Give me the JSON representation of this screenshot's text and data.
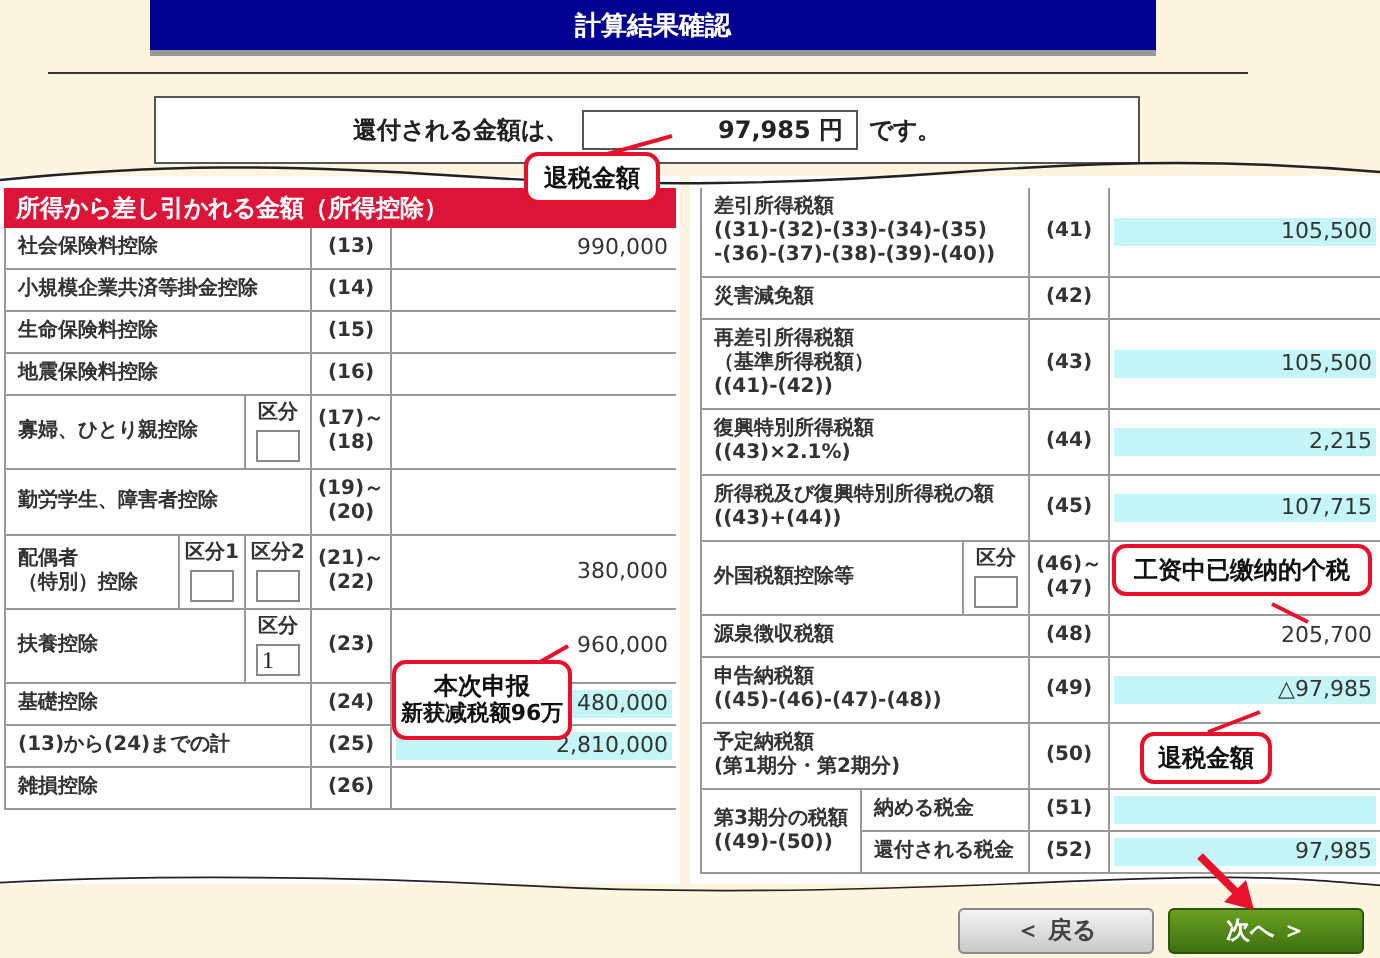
{
  "title": "計算結果確認",
  "refund": {
    "label": "還付される金額は、",
    "value": "97,985",
    "unit": "円",
    "suffix": "です。"
  },
  "left_table": {
    "header": "所得から差し引かれる金額（所得控除）",
    "rows": [
      {
        "label": [
          "社会保険料控除"
        ],
        "code": [
          "(13)"
        ],
        "amount": "990,000",
        "highlighted": false
      },
      {
        "label": [
          "小規模企業共済等掛金控除"
        ],
        "code": [
          "(14)"
        ],
        "highlighted": false
      },
      {
        "label": [
          "生命保険料控除"
        ],
        "code": [
          "(15)"
        ],
        "highlighted": false
      },
      {
        "label": [
          "地震保険料控除"
        ],
        "code": [
          "(16)"
        ],
        "highlighted": false
      },
      {
        "label": [
          "寡婦、ひとり親控除"
        ],
        "boxes": [
          {
            "label": "区分"
          }
        ],
        "code": [
          "(17)～",
          "(18)"
        ],
        "highlighted": false
      },
      {
        "label": [
          "勤労学生、障害者控除"
        ],
        "code": [
          "(19)～",
          "(20)"
        ],
        "highlighted": false
      },
      {
        "label": [
          "配偶者",
          "（特別）控除"
        ],
        "boxes": [
          {
            "label": "区分1"
          },
          {
            "label": "区分2"
          }
        ],
        "code": [
          "(21)～",
          "(22)"
        ],
        "amount": "380,000",
        "highlighted": false
      },
      {
        "label": [
          "扶養控除"
        ],
        "boxes": [
          {
            "label": "区分",
            "value": "1"
          }
        ],
        "code": [
          "(23)"
        ],
        "amount": "960,000",
        "highlighted": false
      },
      {
        "label": [
          "基礎控除"
        ],
        "code": [
          "(24)"
        ],
        "amount": "480,000",
        "highlighted": true
      },
      {
        "label": [
          "(13)から(24)までの計"
        ],
        "code": [
          "(25)"
        ],
        "amount": "2,810,000",
        "highlighted": true
      },
      {
        "label": [
          "雑損控除"
        ],
        "code": [
          "(26)"
        ],
        "highlighted": false
      }
    ]
  },
  "right_table": {
    "rows": [
      {
        "kind": "plain",
        "label": [
          "差引所得税額",
          "((31)-(32)-(33)-(34)-(35)",
          "-(36)-(37)-(38)-(39)-(40))"
        ],
        "code": [
          "(41)"
        ],
        "amount": "105,500",
        "highlighted": true
      },
      {
        "kind": "plain",
        "label": [
          "災害減免額"
        ],
        "code": [
          "(42)"
        ],
        "highlighted": false
      },
      {
        "kind": "plain",
        "label": [
          "再差引所得税額",
          "（基準所得税額）",
          "((41)-(42))"
        ],
        "code": [
          "(43)"
        ],
        "amount": "105,500",
        "highlighted": true
      },
      {
        "kind": "plain",
        "label": [
          "復興特別所得税額",
          "((43)×2.1%)"
        ],
        "code": [
          "(44)"
        ],
        "amount": "2,215",
        "highlighted": true
      },
      {
        "kind": "plain",
        "label": [
          "所得税及び復興特別所得税の額",
          "((43)+(44))"
        ],
        "code": [
          "(45)"
        ],
        "amount": "107,715",
        "highlighted": true
      },
      {
        "kind": "plain",
        "label": [
          "外国税額控除等"
        ],
        "boxes": [
          {
            "label": "区分"
          }
        ],
        "code": [
          "(46)～",
          "(47)"
        ],
        "highlighted": false
      },
      {
        "kind": "plain",
        "label": [
          "源泉徴収税額"
        ],
        "code": [
          "(48)"
        ],
        "amount": "205,700",
        "highlighted": false
      },
      {
        "kind": "plain",
        "label": [
          "申告納税額",
          "((45)-(46)-(47)-(48))"
        ],
        "code": [
          "(49)"
        ],
        "amount": "△97,985",
        "highlighted": true
      },
      {
        "kind": "plain",
        "label": [
          "予定納税額",
          "(第1期分・第2期分)"
        ],
        "code": [
          "(50)"
        ],
        "highlighted": false
      },
      {
        "kind": "group",
        "label": [
          "第3期分の税額",
          "((49)-(50))"
        ],
        "items": [
          {
            "label": "納める税金",
            "code": "(51)",
            "highlighted": true
          },
          {
            "label": "還付される税金",
            "code": "(52)",
            "amount": "97,985",
            "highlighted": true
          }
        ]
      }
    ]
  },
  "callouts": [
    [
      "退税金額"
    ],
    [
      "本次申报",
      "新获减税额96万"
    ],
    [
      "工资中已缴纳的个税"
    ],
    [
      "退税金額"
    ]
  ],
  "buttons": [
    {
      "label": "＜ 戻る",
      "kind": "back"
    },
    {
      "label": "次へ ＞",
      "kind": "next"
    }
  ]
}
